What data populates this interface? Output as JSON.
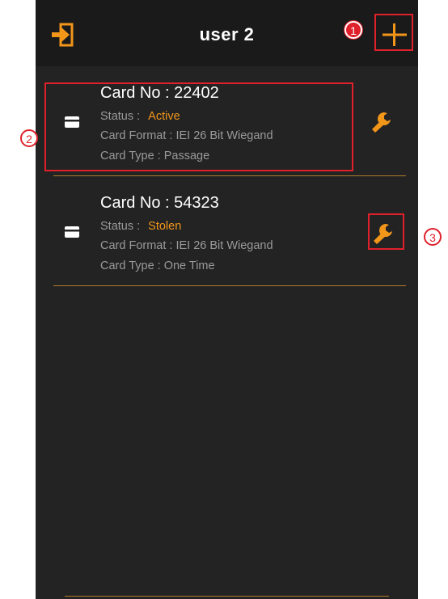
{
  "header": {
    "title": "user 2",
    "back_icon": "exit-to-app-icon",
    "add_icon": "plus-icon"
  },
  "cards": [
    {
      "card_no": "Card No : 22402",
      "status_label": "Status :",
      "status_value": "Active",
      "format": "Card Format : IEI 26 Bit Wiegand",
      "type": "Card Type : Passage",
      "icon": "card-icon",
      "action_icon": "wrench-icon"
    },
    {
      "card_no": "Card No : 54323",
      "status_label": "Status :",
      "status_value": "Stolen",
      "format": "Card Format : IEI 26 Bit Wiegand",
      "type": "Card Type : One Time",
      "icon": "card-icon",
      "action_icon": "wrench-icon"
    }
  ],
  "annotations": [
    "1",
    "2",
    "3"
  ],
  "colors": {
    "accent": "#f2961a",
    "background": "#232323",
    "header": "#1a1a1a",
    "annotation": "#e0212b"
  }
}
